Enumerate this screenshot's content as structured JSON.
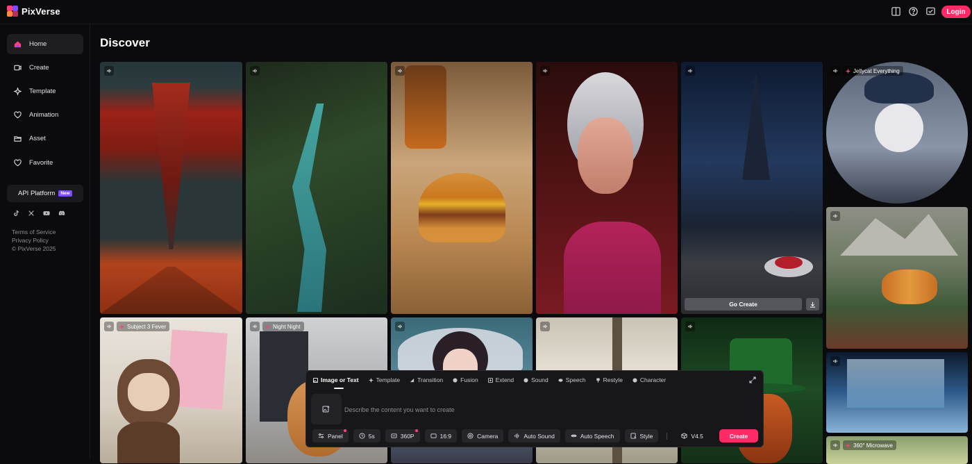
{
  "brand": {
    "name": "PixVerse"
  },
  "header": {
    "login_label": "Login",
    "icons": [
      "book-icon",
      "help-icon",
      "notification-icon"
    ]
  },
  "sidebar": {
    "items": [
      {
        "label": "Home",
        "icon": "home-icon",
        "active": true
      },
      {
        "label": "Create",
        "icon": "create-icon",
        "active": false
      },
      {
        "label": "Template",
        "icon": "sparkle-icon",
        "active": false
      },
      {
        "label": "Animation",
        "icon": "heart-outline-icon",
        "active": false
      },
      {
        "label": "Asset",
        "icon": "folder-icon",
        "active": false
      },
      {
        "label": "Favorite",
        "icon": "favorite-icon",
        "active": false
      }
    ],
    "api_platform": {
      "label": "API Platform",
      "badge": "New"
    },
    "socials": [
      "tiktok-icon",
      "x-icon",
      "youtube-icon",
      "discord-icon"
    ],
    "legal": {
      "terms": "Terms of Service",
      "privacy": "Privacy Policy",
      "copyright": "© PixVerse 2025"
    }
  },
  "main": {
    "title": "Discover",
    "tiles": [
      {
        "tag": ""
      },
      {
        "tag": ""
      },
      {
        "tag": ""
      },
      {
        "tag": ""
      },
      {
        "tag": "",
        "go_create": "Go Create"
      },
      {
        "tag": "Jellycat Everything"
      },
      {
        "tag": ""
      },
      {
        "tag": "Subject 3 Fever"
      },
      {
        "tag": "Night Night"
      },
      {
        "tag": ""
      },
      {
        "tag": ""
      },
      {
        "tag": ""
      },
      {
        "tag": ""
      },
      {
        "tag": "360° Microwave"
      }
    ]
  },
  "creator": {
    "tabs": [
      "Image or Text",
      "Template",
      "Transition",
      "Fusion",
      "Extend",
      "Sound",
      "Speech",
      "Restyle",
      "Character"
    ],
    "active_tab": "Image or Text",
    "prompt_placeholder": "Describe the content you want to create",
    "options": {
      "panel": "Panel",
      "duration": "5s",
      "resolution": "360P",
      "ratio": "16:9",
      "camera": "Camera",
      "auto_sound": "Auto Sound",
      "auto_speech": "Auto Speech",
      "style": "Style",
      "model": "V4.5"
    },
    "create_label": "Create"
  },
  "colors": {
    "accent": "#ff2a66",
    "new_badge": "#7b4dff",
    "background": "#0b0b0d"
  }
}
